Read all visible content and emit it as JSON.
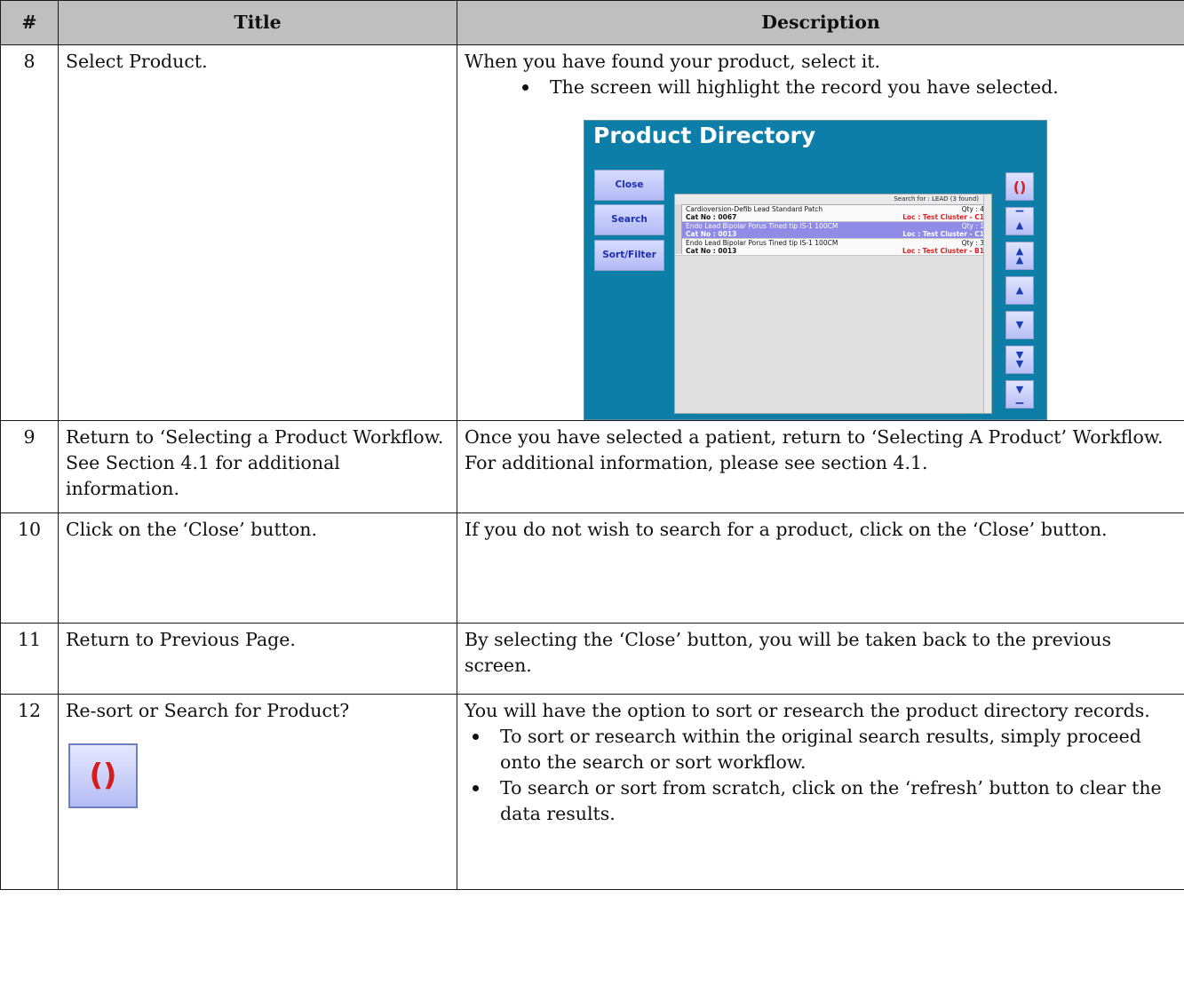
{
  "table": {
    "headers": {
      "num": "#",
      "title": "Title",
      "description": "Description"
    },
    "rows": [
      {
        "num": "8",
        "title": "Select Product.",
        "description": "When you have found your product, select it.",
        "bullets": [
          "The screen will highlight the record you have selected."
        ]
      },
      {
        "num": "9",
        "title": "Return to ‘Selecting a Product Workflow.  See Section 4.1 for additional information.",
        "description": "Once you have selected a patient, return to ‘Selecting A Product’ Workflow.  For additional information, please see section 4.1."
      },
      {
        "num": "10",
        "title": "Click on the ‘Close’ button.",
        "description": "If you do not wish to search for a product, click on the ‘Close’ button."
      },
      {
        "num": "11",
        "title": "Return to Previous Page.",
        "description": "By selecting the ‘Close’ button, you will be taken back to the previous screen."
      },
      {
        "num": "12",
        "title": "Re-sort or Search for Product?",
        "description": "You will have the option to sort or research the product directory records.",
        "bullets": [
          "To sort or research within the original search results, simply proceed onto the search or sort workflow.",
          "To search or sort from scratch, click on the ‘refresh’ button to clear the data results."
        ]
      }
    ]
  },
  "product_directory": {
    "title": "Product Directory",
    "buttons": {
      "close": "Close",
      "search": "Search",
      "sort_filter": "Sort/Filter"
    },
    "list_header": "Search for : LEAD (3 found)",
    "selected_index": 1,
    "records": [
      {
        "name": "Cardioversion-Defib Lead Standard Patch",
        "qty": "Qty : 4",
        "cat": "Cat No : 0067",
        "loc": "Loc : Test Cluster - C1"
      },
      {
        "name": "Endo Lead Bipolar Porus Tined tip IS-1 100CM",
        "qty": "Qty : 1",
        "cat": "Cat No : 0013",
        "loc": "Loc : Test Cluster - C1"
      },
      {
        "name": "Endo Lead Bipolar Porus Tined tip IS-1 100CM",
        "qty": "Qty : 3",
        "cat": "Cat No : 0013",
        "loc": "Loc : Test Cluster - B1"
      }
    ],
    "nav_icons": [
      "refresh-icon",
      "first-page-icon",
      "page-up-icon",
      "row-up-icon",
      "row-down-icon",
      "page-down-icon",
      "last-page-icon"
    ]
  },
  "colors": {
    "header_bg": "#bfbfbf",
    "directory_bg": "#0d7ea7",
    "selected_row": "#8f8be6",
    "location_text": "#e02020",
    "refresh_icon": "#d81c1c"
  }
}
